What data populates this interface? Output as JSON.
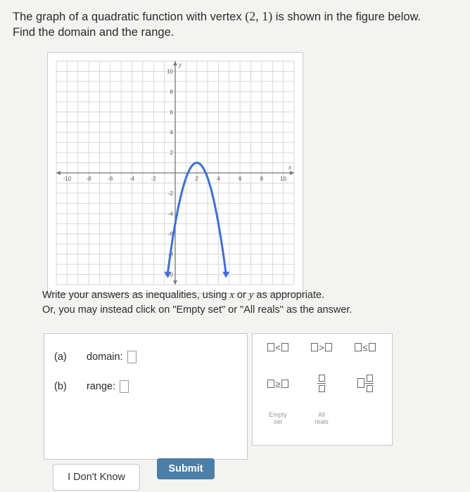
{
  "question": {
    "part1": "The graph of a quadratic function with vertex",
    "vertex": "(2, 1)",
    "part2": "is shown in the figure below.",
    "line2": "Find the domain and the range."
  },
  "graph": {
    "x_axis_label": "x",
    "y_axis_label": "y",
    "x_ticks": [
      "-10",
      "-8",
      "-6",
      "-4",
      "-2",
      "2",
      "4",
      "6",
      "8",
      "10"
    ],
    "y_ticks": [
      "10",
      "8",
      "6",
      "4",
      "2",
      "-2",
      "-4",
      "-6",
      "-8",
      "-10"
    ],
    "xlim": [
      -11,
      11
    ],
    "ylim": [
      -11,
      11
    ],
    "curve_color": "#3f6fd6",
    "function": {
      "vertex": [
        2,
        1
      ],
      "a": -1.5,
      "x_range": [
        -0.7,
        4.7
      ],
      "arrows_down": true
    }
  },
  "instructions": {
    "line1_pre": "Write your answers as inequalities, using",
    "var_x": "x",
    "or": "or",
    "var_y": "y",
    "line1_post": "as appropriate.",
    "line2": "Or, you may instead click on \"Empty set\" or \"All reals\" as the answer."
  },
  "answers": {
    "a_label": "(a)",
    "domain_label": "domain:",
    "b_label": "(b)",
    "range_label": "range:"
  },
  "palette": {
    "less_than": "<",
    "greater_than": ">",
    "less_equal": "≤",
    "greater_equal": "≥",
    "empty_set_line1": "Empty",
    "empty_set_line2": "set",
    "all_reals_line1": "All",
    "all_reals_line2": "reals"
  },
  "buttons": {
    "dont_know": "I Don't Know",
    "submit": "Submit"
  }
}
